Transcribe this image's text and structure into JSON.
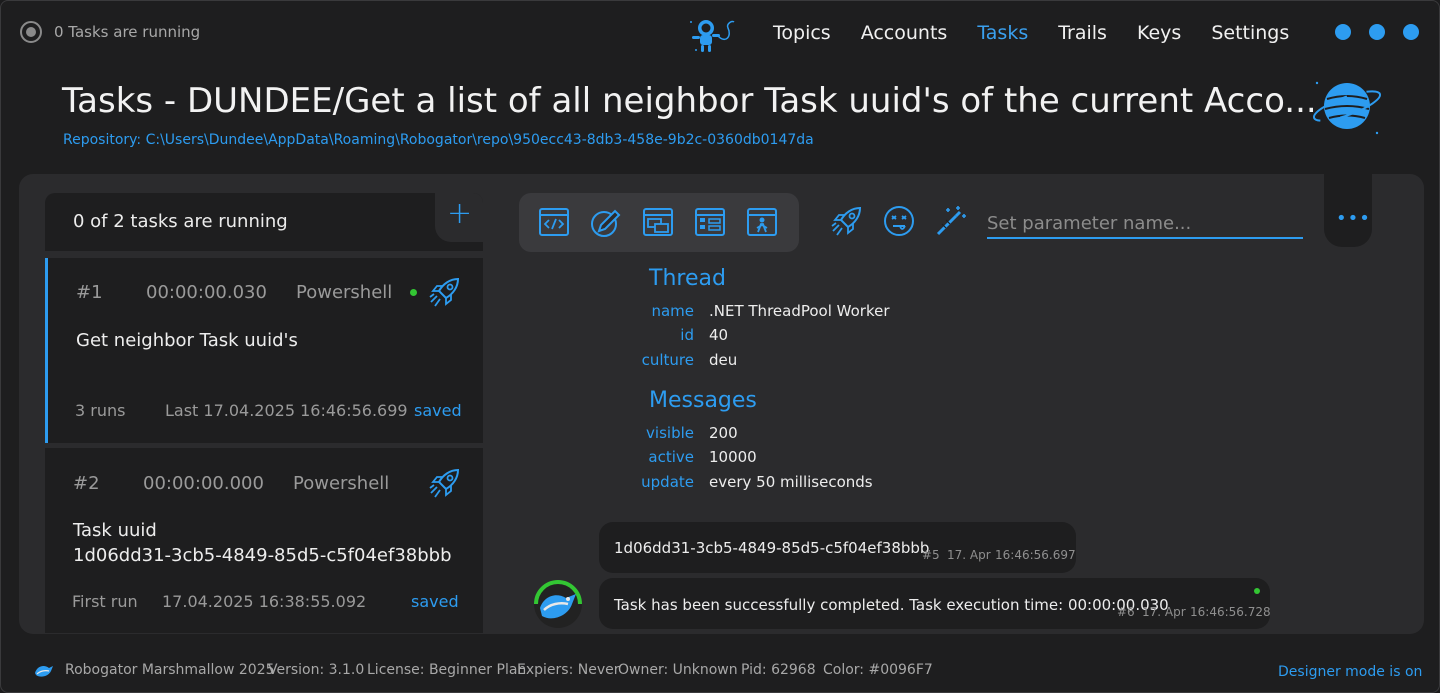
{
  "window": {
    "status_text": "0 Tasks are running"
  },
  "nav": {
    "items": [
      "Topics",
      "Accounts",
      "Tasks",
      "Trails",
      "Keys",
      "Settings"
    ],
    "active": "Tasks"
  },
  "header": {
    "title": "Tasks - DUNDEE/Get a list of all neighbor Task uuid's of the current Acco...",
    "repository": "Repository: C:\\Users\\Dundee\\AppData\\Roaming\\Robogator\\repo\\950ecc43-8db3-458e-9b2c-0360db0147da"
  },
  "tasks_panel": {
    "running_text": "0 of 2 tasks are running",
    "add_label": "+",
    "tasks": [
      {
        "num": "#1",
        "elapsed": "00:00:00.030",
        "language": "Powershell",
        "name": "Get neighbor Task uuid's",
        "runs": "3 runs",
        "last_run": "Last 17.04.2025 16:46:56.699",
        "state": "saved"
      },
      {
        "num": "#2",
        "elapsed": "00:00:00.000",
        "language": "Powershell",
        "name_line1": "Task uuid",
        "name_line2": "1d06dd31-3cb5-4849-85d5-c5f04ef38bbb",
        "runs": "First run",
        "last_run": "17.04.2025 16:38:55.092",
        "state": "saved"
      }
    ]
  },
  "toolbar": {
    "icons": [
      "code-icon",
      "edit-icon",
      "windows-icon",
      "layout-icon",
      "person-icon"
    ],
    "actions": [
      "rocket-icon",
      "face-icon",
      "magic-wand-icon"
    ],
    "param_placeholder": "Set parameter name...",
    "more_label": "•••"
  },
  "thread": {
    "heading": "Thread",
    "rows": [
      {
        "key": "name",
        "value": ".NET ThreadPool Worker"
      },
      {
        "key": "id",
        "value": "40"
      },
      {
        "key": "culture",
        "value": "deu"
      }
    ]
  },
  "messages_info": {
    "heading": "Messages",
    "rows": [
      {
        "key": "visible",
        "value": "200"
      },
      {
        "key": "active",
        "value": "10000"
      },
      {
        "key": "update",
        "value": "every 50 milliseconds"
      }
    ]
  },
  "messages": [
    {
      "text": "1d06dd31-3cb5-4849-85d5-c5f04ef38bbb",
      "num": "#5",
      "date": "17. Apr",
      "time": "16:46:56.697"
    },
    {
      "text": "Task has been successfully completed. Task execution time: 00:00:00.030",
      "num": "#6",
      "date": "17. Apr",
      "time": "16:46:56.728"
    }
  ],
  "footer": {
    "product": "Robogator Marshmallow 2025",
    "version": "Version: 3.1.0",
    "license": "License: Beginner Plan",
    "expires": "Expiers: Never",
    "owner": "Owner: Unknown",
    "pid": "Pid: 62968",
    "color": "Color: #0096F7",
    "designer": "Designer mode is on"
  },
  "colors": {
    "accent": "#2d9cf0",
    "background": "#1e1e1f",
    "panel": "#2b2b2d",
    "live": "#33c633"
  }
}
